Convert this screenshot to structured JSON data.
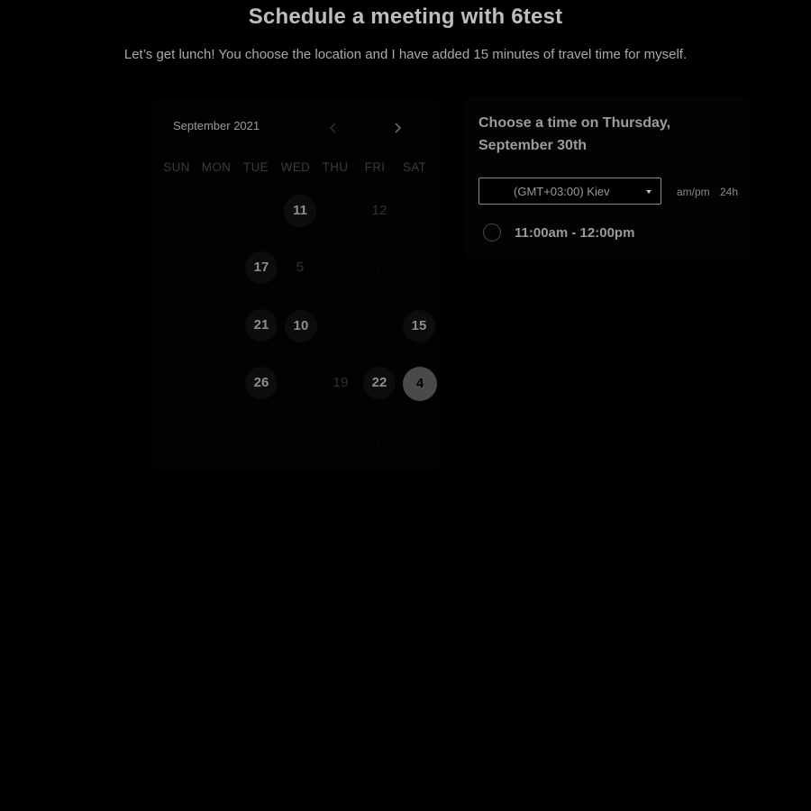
{
  "header": {
    "title": "Schedule a meeting with 6test",
    "description": "Let’s get lunch! You choose the location and I have added 15 minutes of travel time for myself."
  },
  "calendar": {
    "month_label": "September 2021",
    "prev_icon": "chevron-left-icon",
    "next_icon": "chevron-right-icon",
    "weekdays": [
      "SUN",
      "MON",
      "TUE",
      "WED",
      "THU",
      "FRI",
      "SAT"
    ],
    "days": [
      {
        "label": "11",
        "state": "available"
      },
      {
        "label": "12",
        "state": "dim"
      },
      {
        "label": "17",
        "state": "available"
      },
      {
        "label": "5",
        "state": "dim"
      },
      {
        "label": "21",
        "state": "available"
      },
      {
        "label": "10",
        "state": "available"
      },
      {
        "label": "15",
        "state": "available"
      },
      {
        "label": "26",
        "state": "available"
      },
      {
        "label": "19",
        "state": "dim"
      },
      {
        "label": "22",
        "state": "available"
      },
      {
        "label": "4",
        "state": "selected"
      }
    ]
  },
  "times": {
    "heading_line1": "Choose a time on Thursday,",
    "heading_line2": "September 30th",
    "timezone": "(GMT+03:00) Kiev",
    "format_ampm": "am/pm",
    "format_24h": "24h",
    "slots": [
      {
        "label": "11:00am - 12:00pm"
      }
    ]
  }
}
